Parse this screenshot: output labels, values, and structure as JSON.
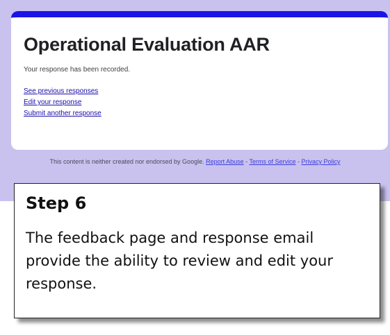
{
  "form": {
    "title": "Operational Evaluation AAR",
    "confirmation": "Your response has been recorded.",
    "links": {
      "see_previous": "See previous responses",
      "edit": "Edit your response",
      "submit_another": "Submit another response"
    },
    "footer": {
      "disclaimer": "This content is neither created nor endorsed by Google.",
      "report_abuse": "Report Abuse",
      "sep1": " - ",
      "terms": "Terms of Service",
      "sep2": " - ",
      "privacy": "Privacy Policy"
    },
    "colors": {
      "header_bar": "#1a14e6",
      "background": "#c9c2ef"
    }
  },
  "callout": {
    "title": "Step 6",
    "body": "The feedback page and response email provide the ability to review and edit your response."
  }
}
